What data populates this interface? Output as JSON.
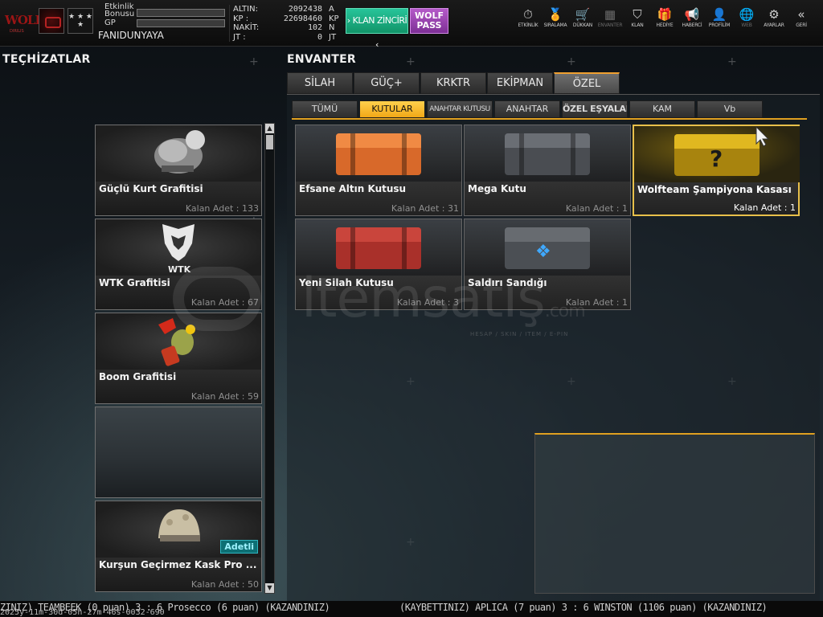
{
  "header": {
    "logo_text": "WOLF",
    "logo_subtext": "DIRILIS",
    "rank_stars": "★ ★ ★ ★",
    "etkinlik_label_line1": "Etkinlik",
    "etkinlik_label_line2": "Bonusu",
    "gp_label": "GP",
    "username": "FANIDUNYAYA",
    "progress": {
      "etkinlik": 0.0,
      "gp": 0.0
    },
    "currency": [
      {
        "name": "ALTIN:",
        "value": "2092438",
        "unit": "A"
      },
      {
        "name": "KP  :",
        "value": "22698460",
        "unit": "KP"
      },
      {
        "name": "NAKİT:",
        "value": "102",
        "unit": "N"
      },
      {
        "name": "JT  :",
        "value": "0",
        "unit": "JT"
      }
    ],
    "klan_button": "› KLAN ZİNCİRİ ‹",
    "wolf_pass_line1": "WOLF",
    "wolf_pass_line2": "PASS",
    "nav": [
      {
        "label": "ETKİNLİK",
        "icon": "stopwatch-icon",
        "glyph": "⏱"
      },
      {
        "label": "SIRALAMA",
        "icon": "medal-icon",
        "glyph": "🏅"
      },
      {
        "label": "DÜKKAN",
        "icon": "cart-icon",
        "glyph": "🛒"
      },
      {
        "label": "ENVANTER",
        "icon": "inventory-icon",
        "glyph": "▦"
      },
      {
        "label": "KLAN",
        "icon": "shield-icon",
        "glyph": "⛉"
      },
      {
        "label": "HEDİYE",
        "icon": "gift-icon",
        "glyph": "🎁"
      },
      {
        "label": "HABERCİ",
        "icon": "megaphone-icon",
        "glyph": "📢"
      },
      {
        "label": "PROFİLİM",
        "icon": "profile-icon",
        "glyph": "👤"
      },
      {
        "label": "WEB",
        "icon": "globe-icon",
        "glyph": "🌐"
      },
      {
        "label": "AYARLAR",
        "icon": "gear-icon",
        "glyph": "⚙"
      },
      {
        "label": "GERİ",
        "icon": "back-icon",
        "glyph": "«"
      }
    ]
  },
  "left": {
    "title": "TEÇHİZATLAR",
    "items": [
      {
        "name": "Güçlü Kurt Grafitisi",
        "count": "Kalan Adet : 133",
        "icon": "wolf-graffiti-icon"
      },
      {
        "name": "WTK Grafitisi",
        "count": "Kalan Adet : 67",
        "icon": "wtk-wolf-logo-icon"
      },
      {
        "name": "Boom Grafitisi",
        "count": "Kalan Adet : 59",
        "icon": "boom-grenade-icon"
      },
      {
        "name": "",
        "count": "",
        "icon": ""
      },
      {
        "name": "Kurşun Geçirmez Kask Pro ...",
        "count": "Kalan Adet : 50",
        "icon": "helmet-icon",
        "badge": "Adetli"
      }
    ]
  },
  "right": {
    "title": "ENVANTER",
    "tabs": [
      "SİLAH",
      "GÜÇ+",
      "KRKTR",
      "EKİPMAN",
      "ÖZEL"
    ],
    "active_tab": "ÖZEL",
    "subtabs": [
      "TÜMÜ",
      "KUTULAR",
      "ANAHTAR KUTUSU",
      "ANAHTAR",
      "ÖZEL EŞYALAR",
      "KAM",
      "Vb"
    ],
    "active_subtab": "KUTULAR",
    "items": [
      {
        "name": "Efsane Altın Kutusu",
        "count": "Kalan Adet : 31",
        "color": "#d8692a",
        "icon": "orange-crate-icon"
      },
      {
        "name": "Mega Kutu",
        "count": "Kalan Adet : 1",
        "color": "#4a4d52",
        "icon": "steel-crate-icon"
      },
      {
        "name": "Wolfteam Şampiyona Kasası",
        "count": "Kalan Adet : 1",
        "color": "#d6a91c",
        "icon": "gold-mystery-crate-icon"
      },
      {
        "name": "Yeni Silah Kutusu",
        "count": "Kalan Adet : 3",
        "color": "#a9302a",
        "icon": "red-crate-icon"
      },
      {
        "name": "Saldırı Sandığı",
        "count": "Kalan Adet : 1",
        "color": "#4b4f54",
        "icon": "assault-chest-icon"
      }
    ],
    "selected_item": "Wolfteam Şampiyona Kasası"
  },
  "watermark": {
    "text": "itemsatış",
    "suffix": ".com",
    "tagline": "HESAP / SKIN / ITEM / E-PIN"
  },
  "ticker": {
    "left": "ZINIZ) TEAMBEEK (0 puan) 3 : 6 Prosecco (6 puan) (KAZANDINIZ)",
    "right": "(KAYBETTINIZ) APLICA (7 puan) 3 : 6 WINSTON (1106 puan) (KAZANDINIZ)",
    "timestamp": "2025y-11m-30d-05h-27m-46s-0032-690"
  },
  "colors": {
    "accent": "#f0a030",
    "selected_border": "#e8c04a",
    "klan_button": "#1aa87a",
    "wolf_pass": "#9a46b2",
    "badge": "#0d6f74"
  }
}
